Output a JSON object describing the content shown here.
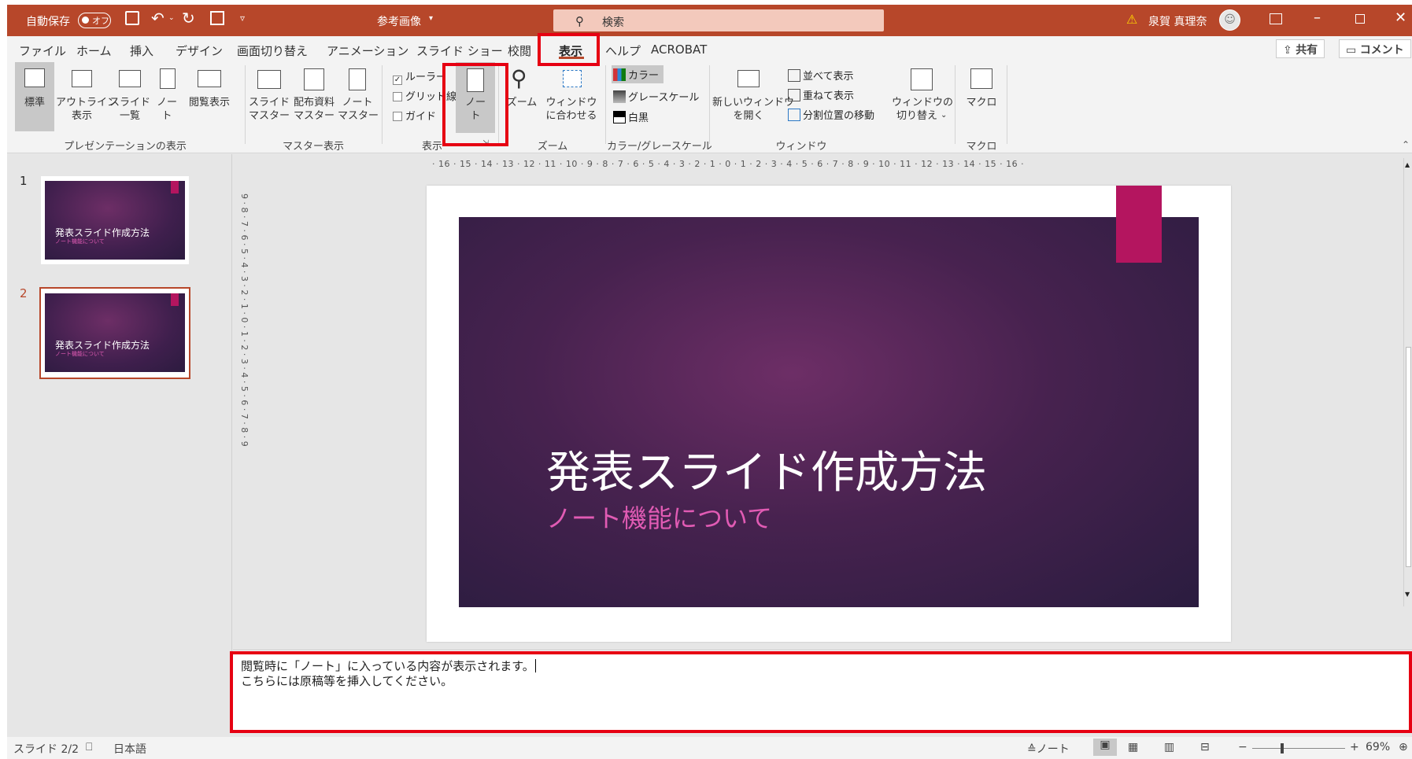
{
  "titlebar": {
    "autosave_label": "自動保存",
    "autosave_state": "オフ",
    "filename": "参考画像",
    "search_placeholder": "検索",
    "user_name": "泉賀 真理奈"
  },
  "tabs": [
    "ファイル",
    "ホーム",
    "挿入",
    "デザイン",
    "画面切り替え",
    "アニメーション",
    "スライド ショー",
    "校閲",
    "表示",
    "ヘルプ",
    "ACROBAT"
  ],
  "share_label": "共有",
  "comment_label": "コメント",
  "ribbon": {
    "presentation_views": {
      "normal": "標準",
      "outline_1": "アウトライン",
      "outline_2": "表示",
      "sorter_1": "スライド",
      "sorter_2": "一覧",
      "notes_page_1": "ノー",
      "notes_page_2": "ト",
      "reading": "閲覧表示",
      "group": "プレゼンテーションの表示"
    },
    "master_views": {
      "slide_1": "スライド",
      "slide_2": "マスター",
      "handout_1": "配布資料",
      "handout_2": "マスター",
      "notes_1": "ノート",
      "notes_2": "マスター",
      "group": "マスター表示"
    },
    "show": {
      "ruler": "ルーラー",
      "gridlines": "グリッド線",
      "guides": "ガイド",
      "notes_1": "ノー",
      "notes_2": "ト",
      "group": "表示"
    },
    "zoom": {
      "zoom": "ズーム",
      "fit_1": "ウィンドウ",
      "fit_2": "に合わせる",
      "group": "ズーム"
    },
    "color": {
      "color": "カラー",
      "grayscale": "グレースケール",
      "bw": "白黒",
      "group": "カラー/グレースケール"
    },
    "window": {
      "new_1": "新しいウィンドウ",
      "new_2": "を開く",
      "arrange": "並べて表示",
      "cascade": "重ねて表示",
      "move_split": "分割位置の移動",
      "group": "ウィンドウ"
    },
    "switch_1": "ウィンドウの",
    "switch_2": "切り替え",
    "macros": {
      "macro": "マクロ",
      "group": "マクロ"
    }
  },
  "thumbnails": [
    {
      "num": "1",
      "title": "発表スライド作成方法",
      "subtitle": "ノート機能について"
    },
    {
      "num": "2",
      "title": "発表スライド作成方法",
      "subtitle": "ノート機能について"
    }
  ],
  "ruler_h": "· 16 · 15 · 14 · 13 · 12 · 11 · 10 · 9 · 8 · 7 · 6 · 5 · 4 · 3 · 2 · 1 · 0 · 1 · 2 · 3 · 4 · 5 · 6 · 7 · 8 · 9 · 10 · 11 · 12 · 13 · 14 · 15 · 16 ·",
  "ruler_v": "9 · 8 · 7 · 6 · 5 · 4 · 3 · 2 · 1 · 0 · 1 · 2 · 3 · 4 · 5 · 6 · 7 · 8 · 9",
  "slide": {
    "title": "発表スライド作成方法",
    "subtitle": "ノート機能について"
  },
  "notes": {
    "line1": "閲覧時に「ノート」に入っている内容が表示されます。",
    "line2": "こちらには原稿等を挿入してください。"
  },
  "statusbar": {
    "slide_count": "スライド 2/2",
    "language": "日本語",
    "notes_button": "ノート",
    "zoom": "69%"
  },
  "colors": {
    "brand": "#b7472a",
    "highlight": "#e60012",
    "slide_accent": "#b4155f",
    "subtitle": "#e15bb4"
  }
}
